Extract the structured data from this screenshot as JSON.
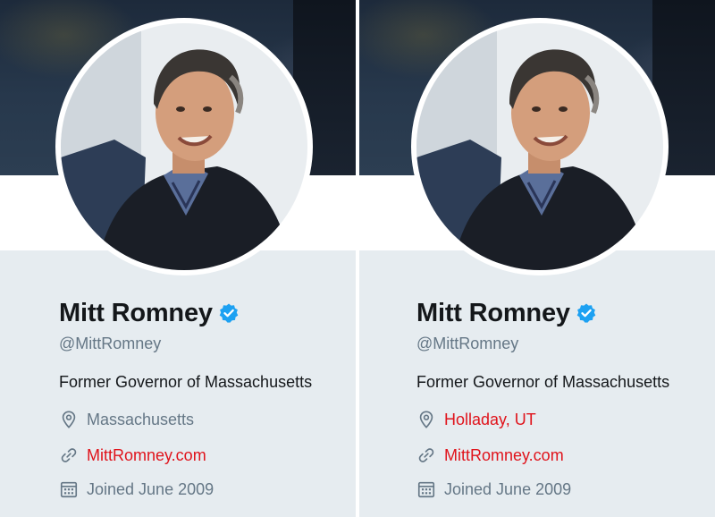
{
  "colors": {
    "background": "#e6ecf0",
    "name_text": "#14171a",
    "secondary_text": "#657786",
    "link_red": "#e0131b",
    "verified_blue": "#1da1f2"
  },
  "profiles": [
    {
      "name": "Mitt Romney",
      "verified_icon": "verified-badge-icon",
      "handle": "@MittRomney",
      "bio": "Former Governor of Massachusetts",
      "location": "Massachusetts",
      "location_icon": "map-pin-icon",
      "website": "MittRomney.com",
      "website_icon": "link-icon",
      "joined": "Joined June 2009",
      "joined_icon": "calendar-icon"
    },
    {
      "name": "Mitt Romney",
      "verified_icon": "verified-badge-icon",
      "handle": "@MittRomney",
      "bio": "Former Governor of Massachusetts",
      "location": "Holladay, UT",
      "location_icon": "map-pin-icon",
      "website": "MittRomney.com",
      "website_icon": "link-icon",
      "joined": "Joined June 2009",
      "joined_icon": "calendar-icon"
    }
  ]
}
